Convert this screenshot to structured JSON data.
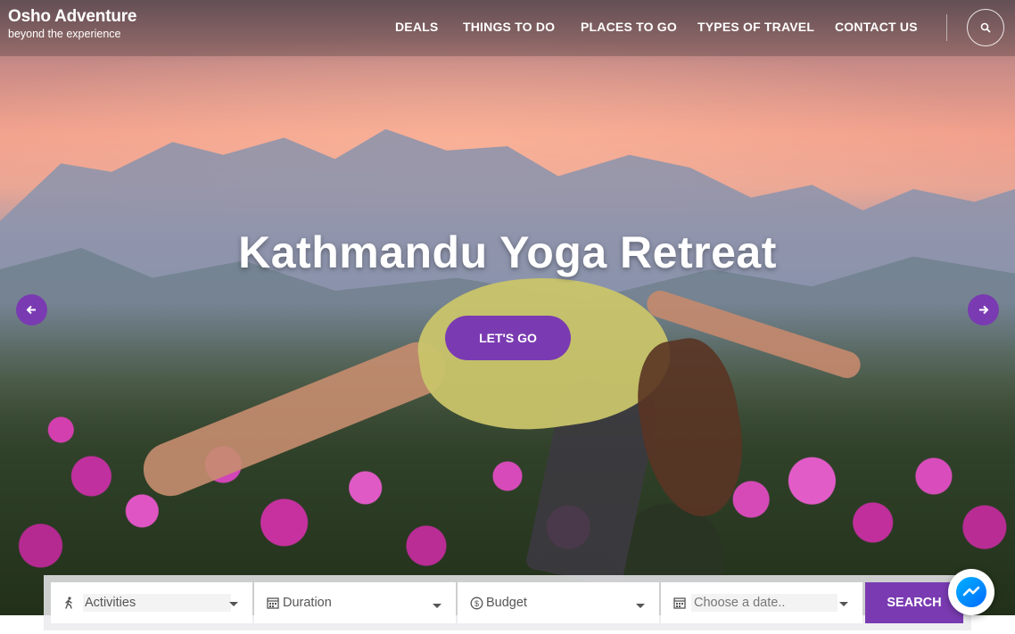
{
  "brand": {
    "name": "Osho Adventure",
    "tagline": "beyond the experience"
  },
  "nav": {
    "items": [
      {
        "label": "DEALS"
      },
      {
        "label": "THINGS TO DO"
      },
      {
        "label": "PLACES TO GO"
      },
      {
        "label": "TYPES OF TRAVEL"
      },
      {
        "label": "CONTACT US"
      }
    ],
    "search_icon": "search-icon"
  },
  "hero": {
    "title": "Kathmandu Yoga Retreat",
    "cta_label": "LET'S GO",
    "prev_icon": "arrow-left-icon",
    "next_icon": "arrow-right-icon"
  },
  "search_bar": {
    "activities": {
      "label": "Activities",
      "icon": "hiking-icon"
    },
    "duration": {
      "label": "Duration",
      "icon": "calendar-icon"
    },
    "budget": {
      "label": "Budget",
      "icon": "dollar-circle-icon"
    },
    "date": {
      "label": "Choose a date..",
      "icon": "calendar-icon"
    },
    "submit_label": "SEARCH"
  },
  "messenger": {
    "icon": "messenger-icon"
  },
  "colors": {
    "accent": "#7a3bb2",
    "text_light": "#ffffff"
  }
}
